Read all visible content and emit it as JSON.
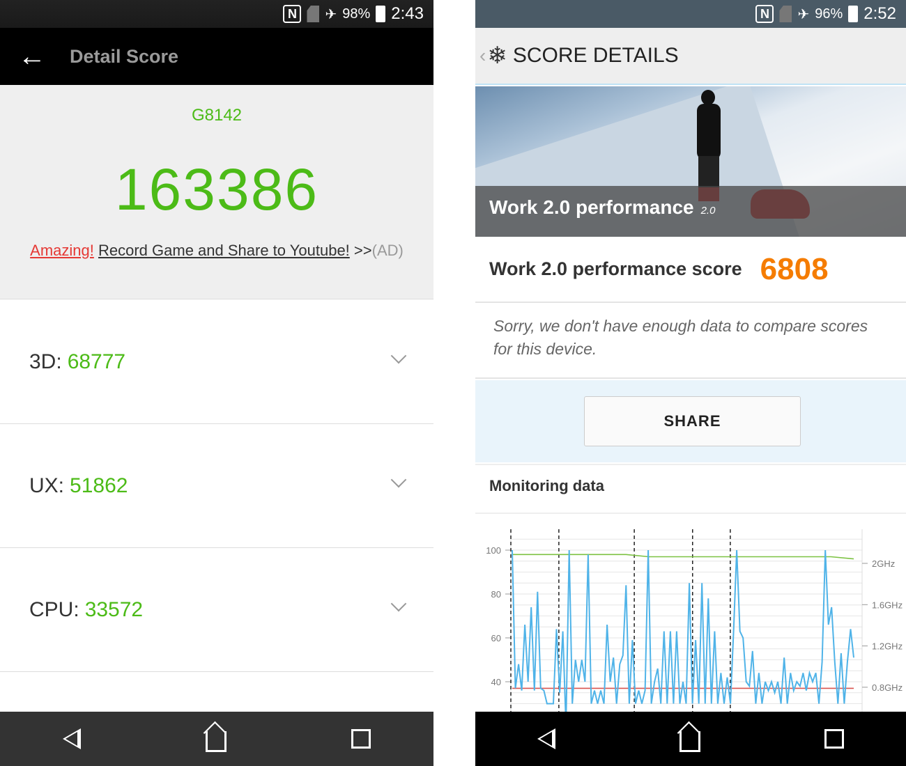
{
  "left": {
    "status": {
      "battery": "98%",
      "time": "2:43",
      "icons": [
        "nfc-icon",
        "no-sim-icon",
        "airplane-icon",
        "battery-icon"
      ]
    },
    "appbar": {
      "title": "Detail Score",
      "back_icon": "arrow-left-icon"
    },
    "model": "G8142",
    "total_score": "163386",
    "ad": {
      "highlight": "Amazing!",
      "text": "Record Game and Share to Youtube!",
      "arrows": ">>",
      "tag": "(AD)"
    },
    "rows": [
      {
        "label": "3D:",
        "value": "68777"
      },
      {
        "label": "UX:",
        "value": "51862"
      },
      {
        "label": "CPU:",
        "value": "33572"
      }
    ],
    "colors": {
      "accent": "#4cbb17",
      "ad_red": "#e53935"
    }
  },
  "right": {
    "status": {
      "battery": "96%",
      "time": "2:52"
    },
    "appbar": {
      "title": "SCORE DETAILS"
    },
    "banner": {
      "title": "Work 2.0 performance",
      "version": "2.0"
    },
    "score": {
      "label": "Work 2.0 performance score",
      "value": "6808"
    },
    "message": "Sorry, we don't have enough data to compare scores for this device.",
    "share_label": "SHARE",
    "monitoring_title": "Monitoring data",
    "colors": {
      "score": "#f57c00",
      "load": "#4fb3e8",
      "frequency": "#7cc242",
      "temperature": "#d9534f"
    }
  },
  "chart_data": {
    "type": "line",
    "y_left_ticks": [
      "100",
      "80",
      "60",
      "40"
    ],
    "y_right_ticks": [
      "2GHz",
      "1.6GHz",
      "1.2GHz",
      "0.8GHz"
    ],
    "ylim": [
      30,
      110
    ],
    "series": [
      {
        "values": [
          100,
          37,
          48,
          36,
          66,
          40,
          74,
          36,
          81,
          37,
          36,
          30,
          30,
          30,
          64,
          35,
          63,
          20,
          100,
          30,
          50,
          40,
          50,
          40,
          98,
          30,
          36,
          30,
          36,
          30,
          66,
          40,
          51,
          30,
          48,
          52,
          84,
          30,
          59,
          30,
          36,
          30,
          36,
          100,
          30,
          40,
          46,
          30,
          63,
          30,
          63,
          30,
          63,
          30,
          40,
          30,
          85,
          30,
          59,
          30,
          85,
          30,
          78,
          30,
          63,
          30,
          44,
          30,
          42,
          30,
          63,
          100,
          63,
          60,
          40,
          38,
          54,
          30,
          44,
          30,
          40,
          36,
          40,
          35,
          40,
          30,
          51,
          30,
          44,
          36,
          40,
          38,
          44,
          36,
          44,
          40,
          44,
          30,
          49,
          100,
          66,
          74,
          49,
          30,
          53,
          30,
          49,
          64,
          51
        ]
      },
      {
        "values": [
          98,
          98,
          98,
          98,
          98,
          98,
          97,
          97,
          97,
          97,
          97,
          97,
          97,
          97,
          97,
          96
        ]
      },
      {
        "values": [
          37,
          37,
          37,
          37,
          37,
          37,
          37,
          37,
          37,
          37,
          37,
          37,
          37
        ]
      }
    ],
    "markers": 5
  }
}
